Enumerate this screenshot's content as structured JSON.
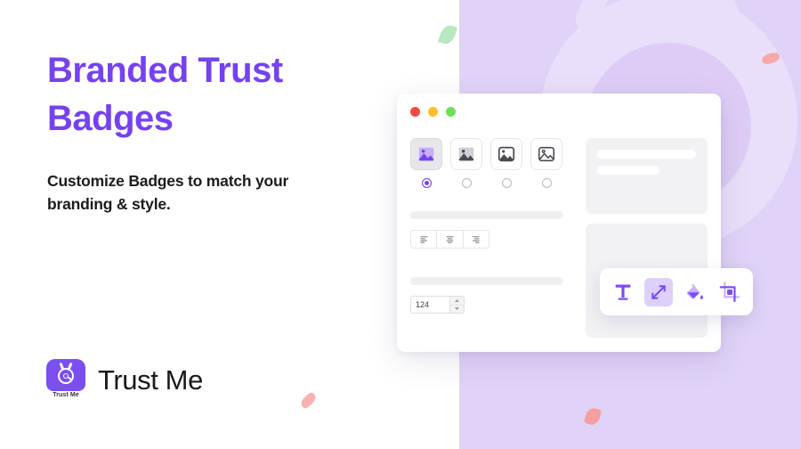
{
  "hero": {
    "headline": "Branded Trust Badges",
    "subhead": "Customize Badges to match your branding & style."
  },
  "brand": {
    "caption": "Trust Me",
    "wordmark": "Trust Me",
    "logo_icon": "trust-me-badge-icon"
  },
  "colors": {
    "accent_purple": "#7542f0",
    "panel_purple": "#e0d3f7",
    "tool_purple": "#7b4ef0",
    "text_dark": "#1b1b22",
    "traffic_red": "#f04a43",
    "traffic_yellow": "#fbc02d",
    "traffic_green": "#6fe05a"
  },
  "window": {
    "traffic_lights": [
      "close-red",
      "minimize-yellow",
      "maximize-green"
    ],
    "badge_styles": [
      {
        "icon": "image-filled-purple-icon",
        "selected": true
      },
      {
        "icon": "image-filled-gray-icon",
        "selected": false
      },
      {
        "icon": "image-framed-filled-icon",
        "selected": false
      },
      {
        "icon": "image-framed-outline-icon",
        "selected": false
      }
    ],
    "align_buttons": [
      {
        "icon": "align-left-icon"
      },
      {
        "icon": "align-center-icon"
      },
      {
        "icon": "align-right-icon"
      }
    ],
    "number_input": {
      "value": "124",
      "stepper_up": "stepper-up-icon",
      "stepper_down": "stepper-down-icon"
    },
    "toolbar": [
      {
        "icon": "text-tool-icon",
        "active": false
      },
      {
        "icon": "resize-tool-icon",
        "active": true
      },
      {
        "icon": "fill-bucket-tool-icon",
        "active": false
      },
      {
        "icon": "crop-tool-icon",
        "active": false
      }
    ]
  },
  "decor": {
    "confetti": [
      "green-leaf",
      "pink-dash-top-right",
      "pink-dash-bottom-left",
      "pink-diamond-bottom-right"
    ],
    "watermark": "mascot-head-watermark"
  }
}
